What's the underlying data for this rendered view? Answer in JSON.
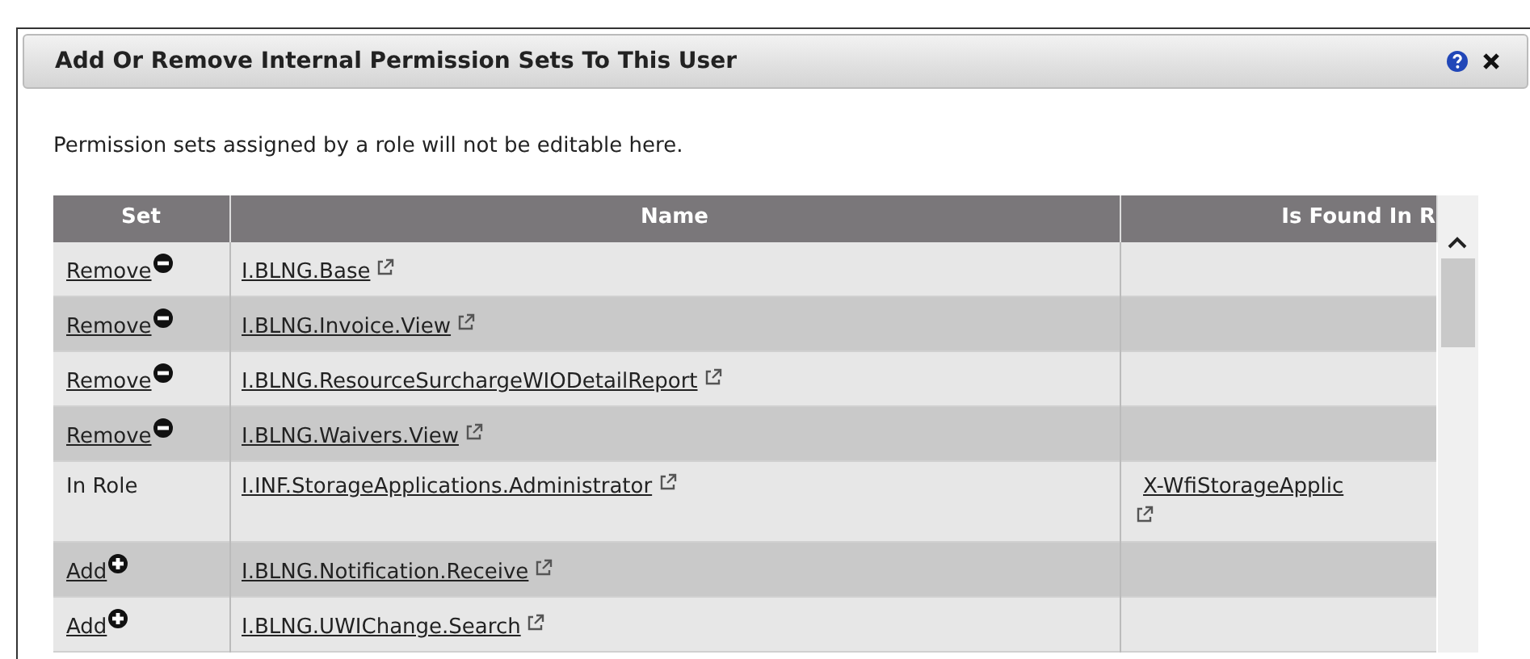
{
  "dialog": {
    "title": "Add Or Remove Internal Permission Sets To This User",
    "note": "Permission sets assigned by a role will not be editable here."
  },
  "table": {
    "columns": [
      "Set",
      "Name",
      "Is Found In R"
    ],
    "rows": [
      {
        "kind": "remove",
        "action": "Remove",
        "name": "I.BLNG.Base"
      },
      {
        "kind": "remove",
        "action": "Remove",
        "name": "I.BLNG.Invoice.View"
      },
      {
        "kind": "remove",
        "action": "Remove",
        "name": "I.BLNG.ResourceSurchargeWIODetailReport"
      },
      {
        "kind": "remove",
        "action": "Remove",
        "name": "I.BLNG.Waivers.View"
      },
      {
        "kind": "in_role",
        "action": "In Role",
        "name": "I.INF.StorageApplications.Administrator",
        "role": "X-WfiStorageApplic"
      },
      {
        "kind": "add",
        "action": "Add",
        "name": "I.BLNG.Notification.Receive"
      },
      {
        "kind": "add",
        "action": "Add",
        "name": "I.BLNG.UWIChange.Search"
      }
    ]
  }
}
